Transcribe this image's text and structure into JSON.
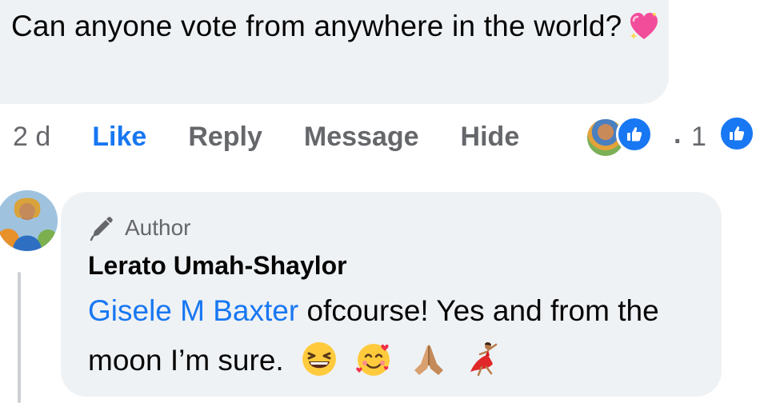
{
  "comment": {
    "text": "Can anyone vote from anywhere in the world?",
    "emoji": "sparkling-heart-icon"
  },
  "actions": {
    "time": "2 d",
    "like": "Like",
    "reply": "Reply",
    "message": "Message",
    "hide": "Hide",
    "separator": "·",
    "reaction_count": "1"
  },
  "reply": {
    "badge": "Author",
    "author_name": "Lerato Umah-Shaylor",
    "mention": "Gisele M Baxter",
    "text": " ofcourse! Yes and from the moon I’m sure.",
    "emojis": [
      "grinning-squinting-face-icon",
      "smiling-face-with-hearts-icon",
      "folded-hands-icon",
      "woman-dancing-icon"
    ]
  },
  "colors": {
    "link": "#1877f2",
    "secondary_text": "#65676b",
    "bubble": "#eff2f5"
  }
}
